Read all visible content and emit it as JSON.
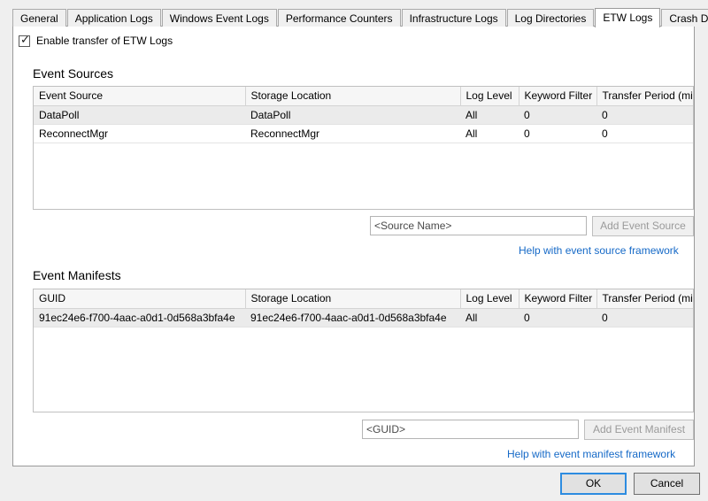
{
  "tabs": [
    {
      "label": "General",
      "active": false
    },
    {
      "label": "Application Logs",
      "active": false
    },
    {
      "label": "Windows Event Logs",
      "active": false
    },
    {
      "label": "Performance Counters",
      "active": false
    },
    {
      "label": "Infrastructure Logs",
      "active": false
    },
    {
      "label": "Log Directories",
      "active": false
    },
    {
      "label": "ETW Logs",
      "active": true
    },
    {
      "label": "Crash Dumps",
      "active": false
    }
  ],
  "enable_transfer": {
    "label": "Enable transfer of ETW Logs",
    "checked": true,
    "check_glyph": "✓"
  },
  "event_sources": {
    "title": "Event Sources",
    "columns": [
      "Event Source",
      "Storage Location",
      "Log Level",
      "Keyword Filter",
      "Transfer Period (min)"
    ],
    "rows": [
      {
        "selected": true,
        "cells": [
          "DataPoll",
          "DataPoll",
          "All",
          "0",
          "0"
        ]
      },
      {
        "selected": false,
        "cells": [
          "ReconnectMgr",
          "ReconnectMgr",
          "All",
          "0",
          "0"
        ]
      }
    ],
    "input_placeholder": "<Source Name>",
    "input_value": "",
    "add_button_label": "Add Event Source",
    "add_button_enabled": false,
    "help_link": "Help with event source framework"
  },
  "event_manifests": {
    "title": "Event Manifests",
    "columns": [
      "GUID",
      "Storage Location",
      "Log Level",
      "Keyword Filter",
      "Transfer Period (min)"
    ],
    "rows": [
      {
        "selected": true,
        "cells": [
          "91ec24e6-f700-4aac-a0d1-0d568a3bfa4e",
          "91ec24e6-f700-4aac-a0d1-0d568a3bfa4e",
          "All",
          "0",
          "0"
        ]
      }
    ],
    "input_placeholder": "<GUID>",
    "input_value": "",
    "add_button_label": "Add Event Manifest",
    "add_button_enabled": false,
    "help_link": "Help with event manifest framework"
  },
  "footer": {
    "ok_label": "OK",
    "cancel_label": "Cancel"
  },
  "colors": {
    "window_background": "#efefef",
    "panel_background": "#ffffff",
    "link": "#1569c7",
    "selected_row": "#ebebeb",
    "header_background": "#f6f6f6",
    "default_button_border": "#2d8ce0"
  }
}
